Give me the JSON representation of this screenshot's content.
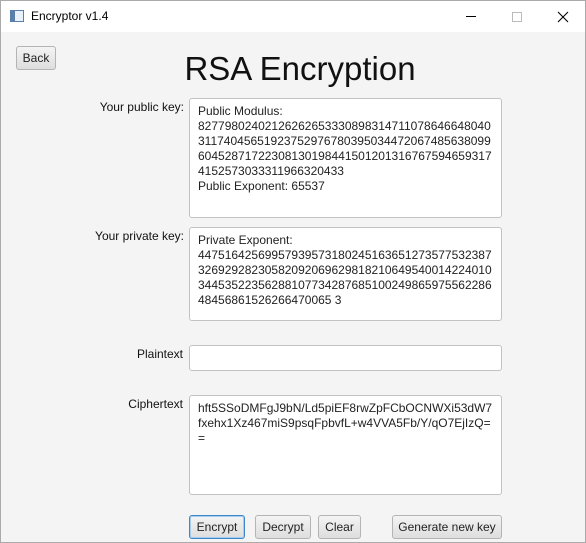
{
  "window": {
    "title": "Encryptor v1.4",
    "controls": {
      "minimize_icon": "minimize-icon",
      "maximize_icon": "maximize-icon",
      "close_icon": "close-icon"
    }
  },
  "toolbar": {
    "back_label": "Back"
  },
  "heading": "RSA Encryption",
  "public_key": {
    "label": "Your public key:",
    "value": "Public Modulus:\n8277980240212626265333089831471107864664804031174045651923752976780395034472067485638099604528717223081301984415012013167675946593174152573033311966320433\nPublic Exponent: 65537"
  },
  "private_key": {
    "label": "Your private key:",
    "value": "Private Exponent:\n44751642569957939573180245163651273577532387326929282305820920696298182106495400142240103445352235628810773428768510024986597556228648456861526266470065 3"
  },
  "plaintext": {
    "label": "Plaintext",
    "value": ""
  },
  "ciphertext": {
    "label": "Ciphertext",
    "value": "hft5SSoDMFgJ9bN/Ld5piEF8rwZpFCbOCNWXi53dW7fxehx1Xz467miS9psqFpbvfL+w4VVA5Fb/Y/qO7EjIzQ=="
  },
  "actions": {
    "encrypt": "Encrypt",
    "decrypt": "Decrypt",
    "clear": "Clear",
    "generate": "Generate new key"
  },
  "colors": {
    "focus_accent": "#3c86c9",
    "window_bg": "#f4f4f4"
  }
}
